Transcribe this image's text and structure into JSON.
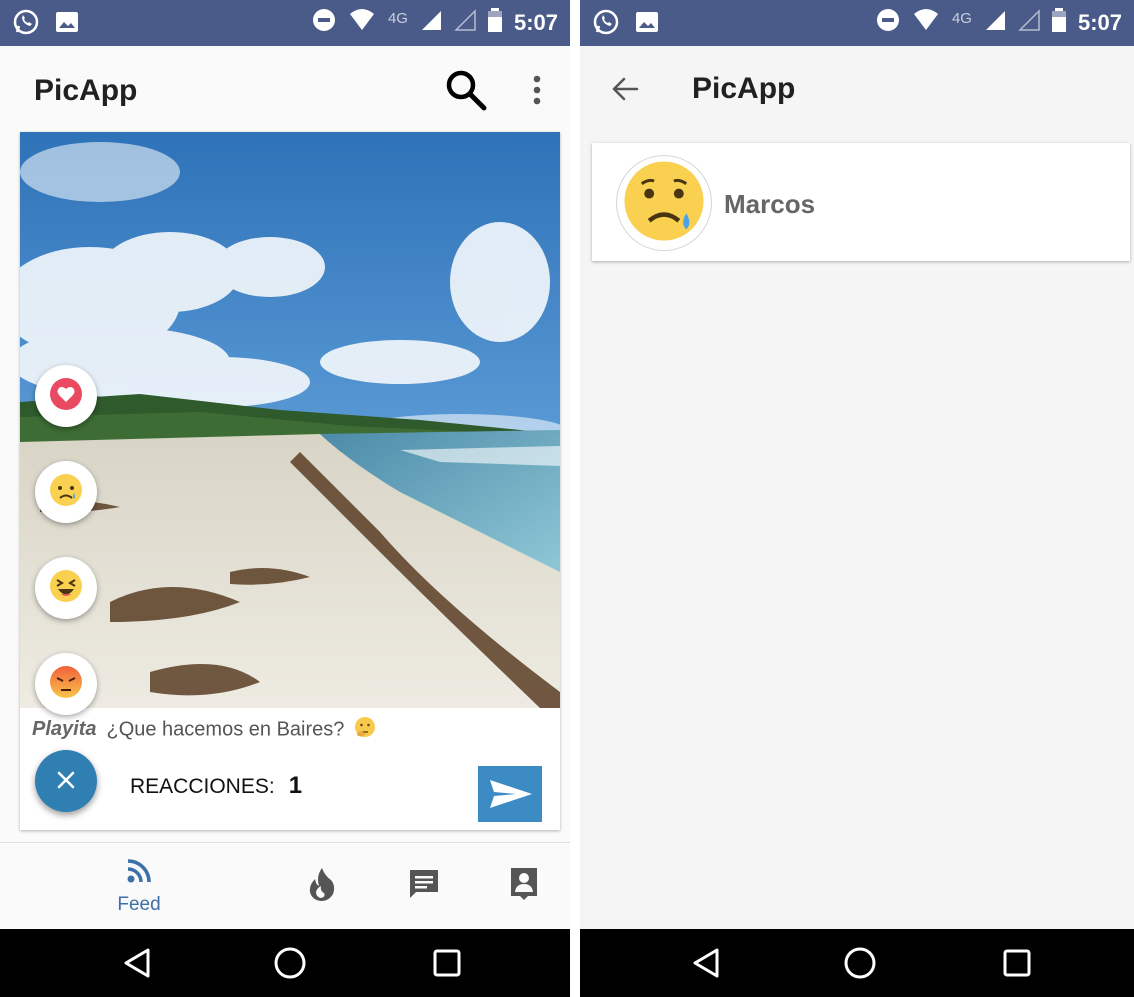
{
  "status_bar": {
    "network": "4G",
    "time": "5:07"
  },
  "app": {
    "title": "PicApp"
  },
  "post": {
    "author": "Playita",
    "caption": "¿Que hacemos en Baires?",
    "reactions_label": "REACCIONES:",
    "reactions_count": "1"
  },
  "reactions": [
    {
      "name": "love",
      "icon": "heart-icon"
    },
    {
      "name": "sad",
      "icon": "sad-crying-emoji-icon"
    },
    {
      "name": "laugh",
      "icon": "laughing-emoji-icon"
    },
    {
      "name": "angry",
      "icon": "angry-emoji-icon"
    }
  ],
  "bottom_nav": {
    "items": [
      {
        "label": "Feed",
        "icon": "rss-feed-icon",
        "active": true
      },
      {
        "label": "",
        "icon": "fire-icon",
        "active": false
      },
      {
        "label": "",
        "icon": "chat-icon",
        "active": false
      },
      {
        "label": "",
        "icon": "contact-icon",
        "active": false
      }
    ]
  },
  "detail": {
    "users": [
      {
        "name": "Marcos",
        "reaction": "sad-crying-emoji-icon"
      }
    ]
  },
  "colors": {
    "status_bar": "#4a5b8a",
    "accent": "#3d8bc4",
    "fab": "#2f7fb3",
    "nav_active": "#3d6fa8",
    "heart": "#e94a62",
    "emoji_yellow": "#f9d04f"
  }
}
